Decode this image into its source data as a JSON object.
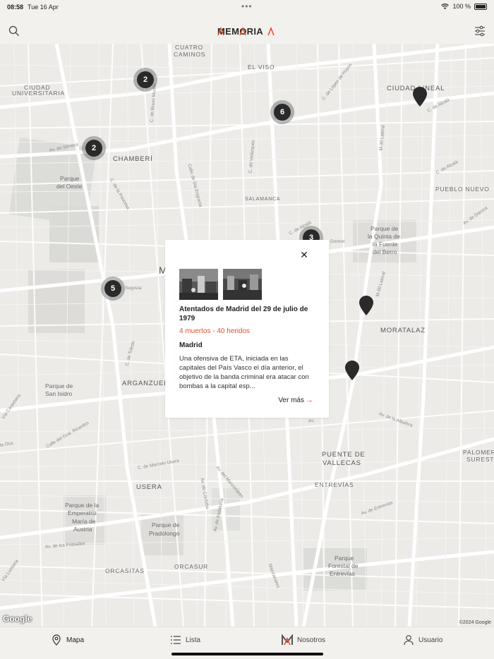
{
  "status": {
    "time": "08:58",
    "date": "Tue 16 Apr",
    "battery": "100 %"
  },
  "header": {
    "logo": "MEMORIA",
    "search_icon": "search-icon",
    "filter_icon": "sliders-icon"
  },
  "map": {
    "labels": {
      "cuatro": "CUATRO",
      "caminos": "CAMINOS",
      "el_viso": "EL VISO",
      "ciudad_lineal": "CIUDAD LINEAL",
      "ciudad": "CIUDAD",
      "universitaria": "UNIVERSITARIA",
      "chamberi": "CHAMBERÍ",
      "parque_del": "Parque",
      "del_oeste": "del Oeste",
      "pueblo_nuevo": "PUEBLO NUEVO",
      "salamanca": "SALAMANCA",
      "parque_quinta1": "Parque de",
      "parque_quinta2": "la Quinta de",
      "parque_quinta3": "la Fuente",
      "parque_quinta4": "del Berro",
      "moratalaz": "MORATALAZ",
      "arganzuela": "ARGANZUEL",
      "parque_san1": "Parque de",
      "parque_san2": "San Isidro",
      "puente": "PUENTE DE",
      "vallecas": "VALLECAS",
      "palomeras1": "PALOMERA",
      "palomeras2": "SURESTE",
      "entrevias": "ENTREVÍAS",
      "usera": "USERA",
      "emperatriz1": "Parque de la",
      "emperatriz2": "Emperatriz",
      "emperatriz3": "María de",
      "emperatriz4": "Austria",
      "pradolongo1": "Parque de",
      "pradolongo2": "Pradolongo",
      "orcasitas": "ORCASITAS",
      "orcasur": "ORCASUR",
      "forestal1": "Parque",
      "forestal2": "Forestal de",
      "forestal3": "Entrevías",
      "madrid_partial": "M",
      "segovia": "Segovia"
    },
    "streets": {
      "seneca": "Av. de Séneca",
      "bravo": "C. de Bravo Murillo",
      "esperanza": "Calle de Sta Engracia",
      "velazquez": "C. de Velázquez",
      "lopez": "C. de López de Hoyos",
      "m30": "M-30 Lateral",
      "alcala1": "C. de Alcalá",
      "alcala2": "C. de Alcalá",
      "daroca": "Av. de Daroca",
      "princesa": "C. de la Princesa",
      "alcala3": "C. de Alcalá",
      "donnell": "Donnel",
      "m30b": "M-30 Lateral",
      "toledo": "C. de Toledo",
      "albufera": "Av. de la Albufera",
      "carpetana": "Vía Carpetana",
      "ricardos": "Calle del Gral. Ricardos",
      "oca": "la Oca",
      "marcelo": "C. de Marcelo Usera",
      "manzanares": "Av. del Manzanares",
      "cordoba": "Av. de Córdoba",
      "andalucia": "Av. de Andalucía",
      "poblados": "Av. de los Poblados",
      "lusitana": "Vía Lusitana",
      "entrevias": "Av. de Entrevías",
      "manzanares2": "Manzanares",
      "av_ao": "Av."
    },
    "clusters": [
      {
        "count": "2"
      },
      {
        "count": "6"
      },
      {
        "count": "2"
      },
      {
        "count": "3"
      },
      {
        "count": "5"
      }
    ],
    "google": "Google",
    "copyright": "©2024 Google"
  },
  "popup": {
    "title": "Atentados de Madrid del 29 de julio de 1979",
    "casualties": "4 muertos - 40  heridos",
    "place": "Madrid",
    "description": "Una ofensiva de ETA, iniciada en las capitales del País Vasco el día anterior, el objetivo de la banda criminal era atacar con bombas a la capital esp...",
    "more_label": "Ver más",
    "close_icon": "close-icon"
  },
  "tabs": [
    {
      "label": "Mapa",
      "icon": "map-pin-icon"
    },
    {
      "label": "Lista",
      "icon": "list-icon"
    },
    {
      "label": "Nosotros",
      "icon": "memoria-logo-icon"
    },
    {
      "label": "Usuario",
      "icon": "user-icon"
    }
  ],
  "colors": {
    "accent": "#e2502f",
    "background": "#f2f1ed",
    "map": "#ecebe8",
    "dark": "#2a2a2a"
  }
}
